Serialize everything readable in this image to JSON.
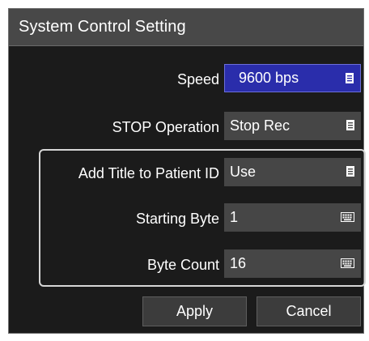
{
  "dialog": {
    "title": "System Control Setting"
  },
  "rows": [
    {
      "label": "Speed",
      "value": "9600 bps",
      "control": "list",
      "selected": true
    },
    {
      "label": "STOP Operation",
      "value": "Stop Rec",
      "control": "list",
      "selected": false
    },
    {
      "label": "Add Title to Patient ID",
      "value": "Use",
      "control": "list",
      "selected": false
    },
    {
      "label": "Starting Byte",
      "value": "1",
      "control": "keyboard",
      "selected": false
    },
    {
      "label": "Byte Count",
      "value": "16",
      "control": "keyboard",
      "selected": false
    }
  ],
  "buttons": {
    "apply": "Apply",
    "cancel": "Cancel"
  },
  "icons": {
    "list": "list-icon",
    "keyboard": "keyboard-icon"
  },
  "colors": {
    "selected_field": "#2a2dab",
    "field": "#464646",
    "background": "#1b1b1b",
    "title_bar": "#484848"
  }
}
